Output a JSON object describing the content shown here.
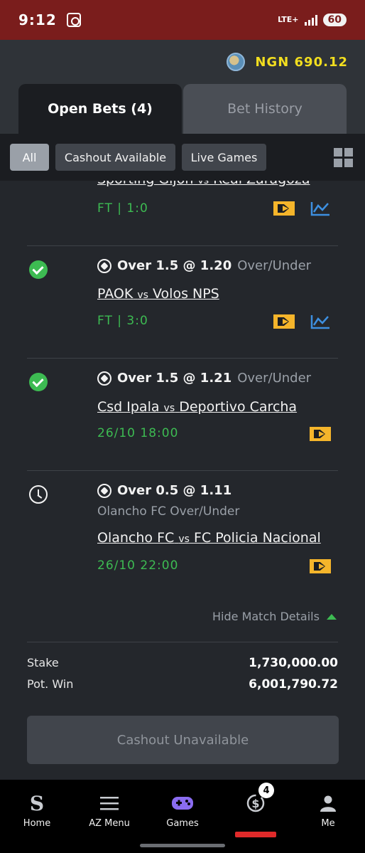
{
  "status_bar": {
    "time": "9:12",
    "network": "LTE+",
    "battery": "60"
  },
  "header": {
    "balance": "NGN 690.12"
  },
  "tabs": [
    {
      "label": "Open Bets (4)"
    },
    {
      "label": "Bet History"
    }
  ],
  "filters": [
    {
      "label": "All"
    },
    {
      "label": "Cashout Available"
    },
    {
      "label": "Live Games"
    }
  ],
  "bets": [
    {
      "home": "Sporting Gijon",
      "vs": "vs",
      "away": "Real Zaragoza",
      "status": "FT | 1:0"
    },
    {
      "selection": "Over 1.5 @ 1.20",
      "market": "Over/Under",
      "home": "PAOK",
      "vs": "vs",
      "away": "Volos NPS",
      "status": "FT | 3:0"
    },
    {
      "selection": "Over 1.5 @ 1.21",
      "market": "Over/Under",
      "home": "Csd Ipala",
      "vs": "vs",
      "away": "Deportivo Carcha",
      "status": "26/10 18:00"
    },
    {
      "selection": "Over 0.5 @ 1.11",
      "sub_market": "Olancho FC Over/Under",
      "home": "Olancho FC",
      "vs": "vs",
      "away": "FC Policia Nacional",
      "status": "26/10 22:00"
    }
  ],
  "details_toggle": "Hide Match Details",
  "summary": {
    "stake_label": "Stake",
    "stake_value": "1,730,000.00",
    "potwin_label": "Pot. Win",
    "potwin_value": "6,001,790.72"
  },
  "cashout_button": "Cashout Unavailable",
  "bottom_nav": [
    {
      "label": "Home",
      "icon": "sportybet-s-icon"
    },
    {
      "label": "AZ Menu",
      "icon": "hamburger-menu-icon"
    },
    {
      "label": "Games",
      "icon": "gamepad-icon"
    },
    {
      "label": "",
      "icon": "open-bets-coin-icon",
      "badge": "4"
    },
    {
      "label": "Me",
      "icon": "user-icon"
    }
  ],
  "colors": {
    "status_bar": "#7a1d1c",
    "balance": "#f2de1f",
    "win_green": "#3dbb52",
    "stream_yellow": "#f5b52b",
    "stats_blue": "#3d8fe0",
    "active_red": "#e02a2a"
  }
}
